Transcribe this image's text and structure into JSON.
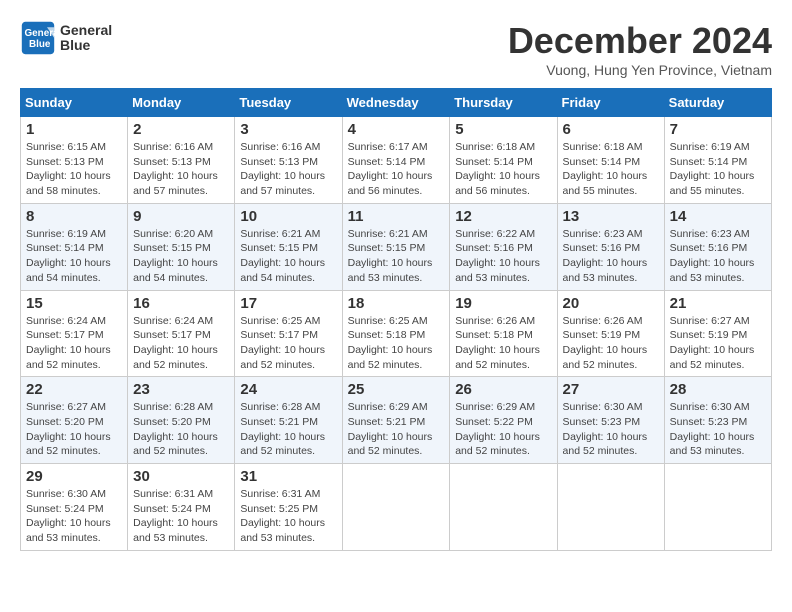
{
  "header": {
    "logo_line1": "General",
    "logo_line2": "Blue",
    "month_title": "December 2024",
    "location": "Vuong, Hung Yen Province, Vietnam"
  },
  "days_of_week": [
    "Sunday",
    "Monday",
    "Tuesday",
    "Wednesday",
    "Thursday",
    "Friday",
    "Saturday"
  ],
  "weeks": [
    [
      {
        "day": "1",
        "sunrise": "6:15 AM",
        "sunset": "5:13 PM",
        "daylight": "10 hours and 58 minutes."
      },
      {
        "day": "2",
        "sunrise": "6:16 AM",
        "sunset": "5:13 PM",
        "daylight": "10 hours and 57 minutes."
      },
      {
        "day": "3",
        "sunrise": "6:16 AM",
        "sunset": "5:13 PM",
        "daylight": "10 hours and 57 minutes."
      },
      {
        "day": "4",
        "sunrise": "6:17 AM",
        "sunset": "5:14 PM",
        "daylight": "10 hours and 56 minutes."
      },
      {
        "day": "5",
        "sunrise": "6:18 AM",
        "sunset": "5:14 PM",
        "daylight": "10 hours and 56 minutes."
      },
      {
        "day": "6",
        "sunrise": "6:18 AM",
        "sunset": "5:14 PM",
        "daylight": "10 hours and 55 minutes."
      },
      {
        "day": "7",
        "sunrise": "6:19 AM",
        "sunset": "5:14 PM",
        "daylight": "10 hours and 55 minutes."
      }
    ],
    [
      {
        "day": "8",
        "sunrise": "6:19 AM",
        "sunset": "5:14 PM",
        "daylight": "10 hours and 54 minutes."
      },
      {
        "day": "9",
        "sunrise": "6:20 AM",
        "sunset": "5:15 PM",
        "daylight": "10 hours and 54 minutes."
      },
      {
        "day": "10",
        "sunrise": "6:21 AM",
        "sunset": "5:15 PM",
        "daylight": "10 hours and 54 minutes."
      },
      {
        "day": "11",
        "sunrise": "6:21 AM",
        "sunset": "5:15 PM",
        "daylight": "10 hours and 53 minutes."
      },
      {
        "day": "12",
        "sunrise": "6:22 AM",
        "sunset": "5:16 PM",
        "daylight": "10 hours and 53 minutes."
      },
      {
        "day": "13",
        "sunrise": "6:23 AM",
        "sunset": "5:16 PM",
        "daylight": "10 hours and 53 minutes."
      },
      {
        "day": "14",
        "sunrise": "6:23 AM",
        "sunset": "5:16 PM",
        "daylight": "10 hours and 53 minutes."
      }
    ],
    [
      {
        "day": "15",
        "sunrise": "6:24 AM",
        "sunset": "5:17 PM",
        "daylight": "10 hours and 52 minutes."
      },
      {
        "day": "16",
        "sunrise": "6:24 AM",
        "sunset": "5:17 PM",
        "daylight": "10 hours and 52 minutes."
      },
      {
        "day": "17",
        "sunrise": "6:25 AM",
        "sunset": "5:17 PM",
        "daylight": "10 hours and 52 minutes."
      },
      {
        "day": "18",
        "sunrise": "6:25 AM",
        "sunset": "5:18 PM",
        "daylight": "10 hours and 52 minutes."
      },
      {
        "day": "19",
        "sunrise": "6:26 AM",
        "sunset": "5:18 PM",
        "daylight": "10 hours and 52 minutes."
      },
      {
        "day": "20",
        "sunrise": "6:26 AM",
        "sunset": "5:19 PM",
        "daylight": "10 hours and 52 minutes."
      },
      {
        "day": "21",
        "sunrise": "6:27 AM",
        "sunset": "5:19 PM",
        "daylight": "10 hours and 52 minutes."
      }
    ],
    [
      {
        "day": "22",
        "sunrise": "6:27 AM",
        "sunset": "5:20 PM",
        "daylight": "10 hours and 52 minutes."
      },
      {
        "day": "23",
        "sunrise": "6:28 AM",
        "sunset": "5:20 PM",
        "daylight": "10 hours and 52 minutes."
      },
      {
        "day": "24",
        "sunrise": "6:28 AM",
        "sunset": "5:21 PM",
        "daylight": "10 hours and 52 minutes."
      },
      {
        "day": "25",
        "sunrise": "6:29 AM",
        "sunset": "5:21 PM",
        "daylight": "10 hours and 52 minutes."
      },
      {
        "day": "26",
        "sunrise": "6:29 AM",
        "sunset": "5:22 PM",
        "daylight": "10 hours and 52 minutes."
      },
      {
        "day": "27",
        "sunrise": "6:30 AM",
        "sunset": "5:23 PM",
        "daylight": "10 hours and 52 minutes."
      },
      {
        "day": "28",
        "sunrise": "6:30 AM",
        "sunset": "5:23 PM",
        "daylight": "10 hours and 53 minutes."
      }
    ],
    [
      {
        "day": "29",
        "sunrise": "6:30 AM",
        "sunset": "5:24 PM",
        "daylight": "10 hours and 53 minutes."
      },
      {
        "day": "30",
        "sunrise": "6:31 AM",
        "sunset": "5:24 PM",
        "daylight": "10 hours and 53 minutes."
      },
      {
        "day": "31",
        "sunrise": "6:31 AM",
        "sunset": "5:25 PM",
        "daylight": "10 hours and 53 minutes."
      },
      null,
      null,
      null,
      null
    ]
  ]
}
